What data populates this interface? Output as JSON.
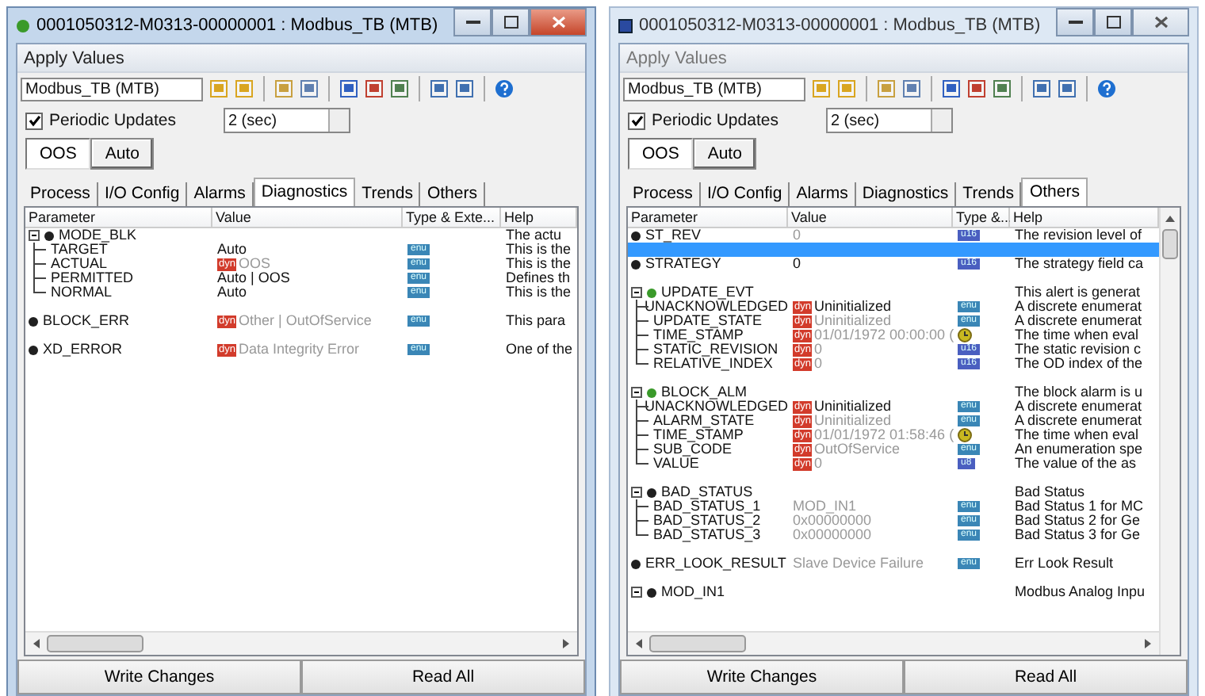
{
  "windows": [
    {
      "title": "0001050312-M0313-00000001 : Modbus_TB (MTB)",
      "active": true,
      "menu": "Apply Values",
      "device_field": "Modbus_TB (MTB)",
      "periodic": {
        "label": "Periodic Updates",
        "checked": true
      },
      "interval": "2 (sec)",
      "modes": [
        {
          "label": "OOS",
          "selected": true
        },
        {
          "label": "Auto",
          "selected": false
        }
      ],
      "tabs": [
        {
          "label": "Process",
          "selected": false
        },
        {
          "label": "I/O Config",
          "selected": false
        },
        {
          "label": "Alarms",
          "selected": false
        },
        {
          "label": "Diagnostics",
          "selected": true
        },
        {
          "label": "Trends",
          "selected": false
        },
        {
          "label": "Others",
          "selected": false
        }
      ],
      "columns": [
        "Parameter",
        "Value",
        "Type & Exte...",
        "Help"
      ],
      "rows": [
        {
          "kind": "group",
          "name": "MODE_BLK",
          "color": "#202020",
          "expanded": true,
          "selected": false,
          "help": "The actu",
          "children": [
            {
              "name": "TARGET",
              "value": "Auto",
              "dim": false,
              "type": {
                "kind": "tag",
                "label": "enu"
              },
              "help": "This is the"
            },
            {
              "name": "ACTUAL",
              "value_tag": "dyn",
              "value": "OOS",
              "dim": true,
              "type": {
                "kind": "tag",
                "label": "enu"
              },
              "help": "This is the"
            },
            {
              "name": "PERMITTED",
              "value": "Auto | OOS",
              "dim": false,
              "type": {
                "kind": "tag",
                "label": "enu"
              },
              "help": "Defines th"
            },
            {
              "name": "NORMAL",
              "value": "Auto",
              "dim": false,
              "type": {
                "kind": "tag",
                "label": "enu"
              },
              "help": "This is the"
            }
          ]
        },
        {
          "kind": "param",
          "name": "BLOCK_ERR",
          "color": "#202020",
          "selected": false,
          "value_tag": "dyn",
          "value": "Other | OutOfService",
          "dim": true,
          "type": {
            "kind": "tag",
            "label": "enu"
          },
          "help": "This para"
        },
        {
          "kind": "param",
          "name": "XD_ERROR",
          "color": "#202020",
          "selected": false,
          "value_tag": "dyn",
          "value": "Data Integrity Error",
          "dim": true,
          "type": {
            "kind": "tag",
            "label": "enu"
          },
          "help": "One of the"
        }
      ],
      "buttons": [
        "Write Changes",
        "Read All"
      ]
    },
    {
      "title": "0001050312-M0313-00000001 : Modbus_TB (MTB)",
      "active": false,
      "menu": "Apply Values",
      "device_field": "Modbus_TB (MTB)",
      "periodic": {
        "label": "Periodic Updates",
        "checked": true
      },
      "interval": "2 (sec)",
      "modes": [
        {
          "label": "OOS",
          "selected": true
        },
        {
          "label": "Auto",
          "selected": false
        }
      ],
      "tabs": [
        {
          "label": "Process",
          "selected": false
        },
        {
          "label": "I/O Config",
          "selected": false
        },
        {
          "label": "Alarms",
          "selected": false
        },
        {
          "label": "Diagnostics",
          "selected": false
        },
        {
          "label": "Trends",
          "selected": false
        },
        {
          "label": "Others",
          "selected": true
        }
      ],
      "columns": [
        "Parameter",
        "Value",
        "Type &...",
        "Help"
      ],
      "rows": [
        {
          "kind": "param",
          "name": "ST_REV",
          "color": "#202020",
          "selected": false,
          "value": "0",
          "dim": true,
          "type": {
            "kind": "tag",
            "label": "u16"
          },
          "help": "The revision level of"
        },
        {
          "kind": "blank",
          "selected": true
        },
        {
          "kind": "param",
          "name": "STRATEGY",
          "color": "#202020",
          "selected": false,
          "value": "0",
          "dim": false,
          "type": {
            "kind": "tag",
            "label": "u16"
          },
          "help": "The strategy field ca"
        },
        {
          "kind": "group",
          "name": "UPDATE_EVT",
          "color": "#3a9a2a",
          "expanded": true,
          "selected": false,
          "help": "This alert is generat",
          "children": [
            {
              "name": "UNACKNOWLEDGED",
              "value_tag": "dyn",
              "value": "Uninitialized",
              "dim": false,
              "type": {
                "kind": "tag",
                "label": "enu"
              },
              "help": "A discrete enumerat"
            },
            {
              "name": "UPDATE_STATE",
              "value_tag": "dyn",
              "value": "Uninitialized",
              "dim": true,
              "type": {
                "kind": "tag",
                "label": "enu"
              },
              "help": "A discrete enumerat"
            },
            {
              "name": "TIME_STAMP",
              "value_tag": "dyn",
              "value": "01/01/1972 00:00:00 (",
              "dim": true,
              "type": {
                "kind": "clock"
              },
              "help": "The time when eval"
            },
            {
              "name": "STATIC_REVISION",
              "value_tag": "dyn",
              "value": "0",
              "dim": true,
              "type": {
                "kind": "tag",
                "label": "u16"
              },
              "help": "The static revision c"
            },
            {
              "name": "RELATIVE_INDEX",
              "value_tag": "dyn",
              "value": "0",
              "dim": true,
              "type": {
                "kind": "tag",
                "label": "u16"
              },
              "help": "The OD index of the"
            }
          ]
        },
        {
          "kind": "group",
          "name": "BLOCK_ALM",
          "color": "#3a9a2a",
          "expanded": true,
          "selected": false,
          "help": "The block alarm is u",
          "children": [
            {
              "name": "UNACKNOWLEDGED",
              "value_tag": "dyn",
              "value": "Uninitialized",
              "dim": false,
              "type": {
                "kind": "tag",
                "label": "enu"
              },
              "help": "A discrete enumerat"
            },
            {
              "name": "ALARM_STATE",
              "value_tag": "dyn",
              "value": "Uninitialized",
              "dim": true,
              "type": {
                "kind": "tag",
                "label": "enu"
              },
              "help": "A discrete enumerat"
            },
            {
              "name": "TIME_STAMP",
              "value_tag": "dyn",
              "value": "01/01/1972 01:58:46 (",
              "dim": true,
              "type": {
                "kind": "clock"
              },
              "help": "The time when eval"
            },
            {
              "name": "SUB_CODE",
              "value_tag": "dyn",
              "value": "OutOfService",
              "dim": true,
              "type": {
                "kind": "tag",
                "label": "enu"
              },
              "help": "An enumeration spe"
            },
            {
              "name": "VALUE",
              "value_tag": "dyn",
              "value": "0",
              "dim": true,
              "type": {
                "kind": "tag",
                "label": "u8"
              },
              "help": "The value of the as"
            }
          ]
        },
        {
          "kind": "group",
          "name": "BAD_STATUS",
          "color": "#202020",
          "expanded": true,
          "selected": false,
          "help": "Bad Status",
          "children": [
            {
              "name": "BAD_STATUS_1",
              "value": "MOD_IN1",
              "dim": true,
              "type": {
                "kind": "tag",
                "label": "enu"
              },
              "help": "Bad Status 1 for MC"
            },
            {
              "name": "BAD_STATUS_2",
              "value": "0x00000000",
              "dim": true,
              "type": {
                "kind": "tag",
                "label": "enu"
              },
              "help": "Bad Status 2 for Ge"
            },
            {
              "name": "BAD_STATUS_3",
              "value": "0x00000000",
              "dim": true,
              "type": {
                "kind": "tag",
                "label": "enu"
              },
              "help": "Bad Status 3 for Ge"
            }
          ]
        },
        {
          "kind": "param",
          "name": "ERR_LOOK_RESULT",
          "color": "#202020",
          "selected": false,
          "value": "Slave Device Failure",
          "dim": true,
          "type": {
            "kind": "tag",
            "label": "enu"
          },
          "help": "Err Look Result"
        },
        {
          "kind": "group",
          "name": "MOD_IN1",
          "color": "#202020",
          "expanded": true,
          "selected": false,
          "help": "Modbus Analog Inpu",
          "children": []
        }
      ],
      "buttons": [
        "Write Changes",
        "Read All"
      ]
    }
  ]
}
